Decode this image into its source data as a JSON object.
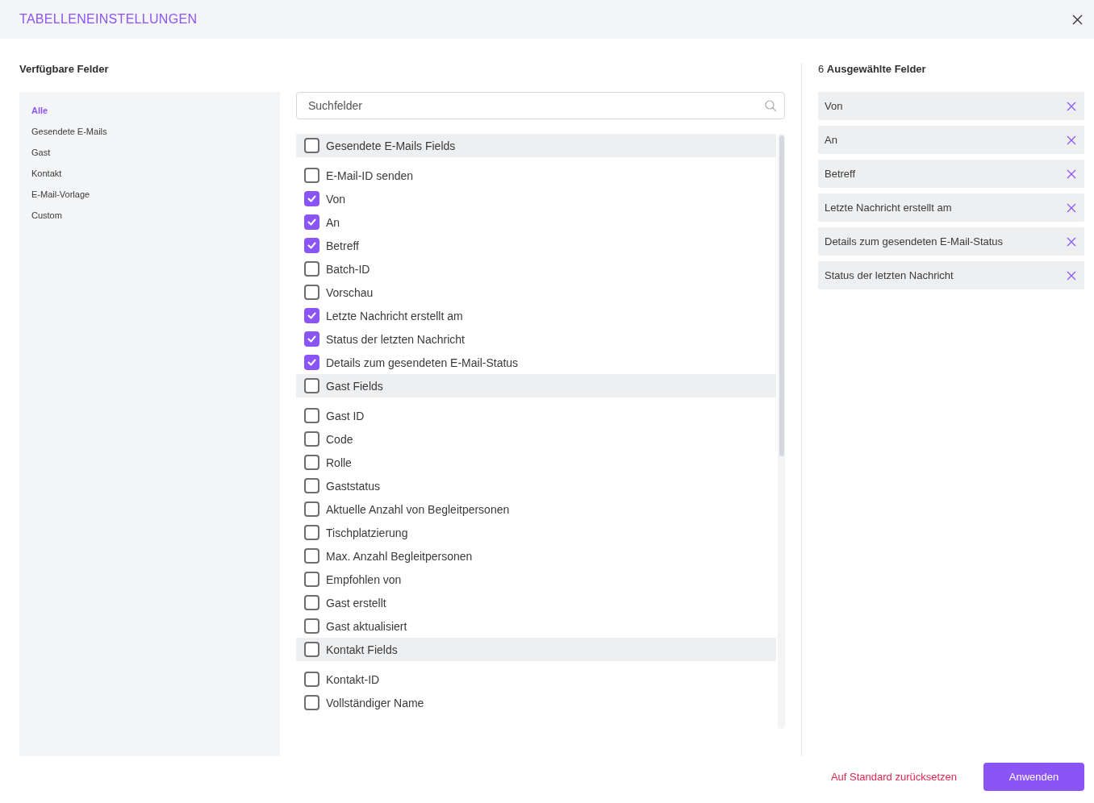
{
  "dialog": {
    "title": "TABELLENEINSTELLUNGEN"
  },
  "available": {
    "heading": "Verfügbare Felder",
    "categories": [
      {
        "label": "Alle",
        "selected": true
      },
      {
        "label": "Gesendete E-Mails",
        "selected": false
      },
      {
        "label": "Gast",
        "selected": false
      },
      {
        "label": "Kontakt",
        "selected": false
      },
      {
        "label": "E-Mail-Vorlage",
        "selected": false
      },
      {
        "label": "Custom",
        "selected": false
      }
    ],
    "search": {
      "placeholder": "Suchfelder"
    },
    "groups": [
      {
        "label": "Gesendete E-Mails Fields",
        "checked": false,
        "fields": [
          {
            "label": "E-Mail-ID senden",
            "checked": false
          },
          {
            "label": "Von",
            "checked": true
          },
          {
            "label": "An",
            "checked": true
          },
          {
            "label": "Betreff",
            "checked": true
          },
          {
            "label": "Batch-ID",
            "checked": false
          },
          {
            "label": "Vorschau",
            "checked": false
          },
          {
            "label": "Letzte Nachricht erstellt am",
            "checked": true
          },
          {
            "label": "Status der letzten Nachricht",
            "checked": true
          },
          {
            "label": "Details zum gesendeten E-Mail-Status",
            "checked": true
          }
        ]
      },
      {
        "label": "Gast Fields",
        "checked": false,
        "fields": [
          {
            "label": "Gast ID",
            "checked": false
          },
          {
            "label": "Code",
            "checked": false
          },
          {
            "label": "Rolle",
            "checked": false
          },
          {
            "label": "Gaststatus",
            "checked": false
          },
          {
            "label": "Aktuelle Anzahl von Begleitpersonen",
            "checked": false
          },
          {
            "label": "Tischplatzierung",
            "checked": false
          },
          {
            "label": "Max. Anzahl Begleitpersonen",
            "checked": false
          },
          {
            "label": "Empfohlen von",
            "checked": false
          },
          {
            "label": "Gast erstellt",
            "checked": false
          },
          {
            "label": "Gast aktualisiert",
            "checked": false
          }
        ]
      },
      {
        "label": "Kontakt Fields",
        "checked": false,
        "fields": [
          {
            "label": "Kontakt-ID",
            "checked": false
          },
          {
            "label": "Vollständiger Name",
            "checked": false
          }
        ]
      }
    ]
  },
  "selected": {
    "heading": "6 **Ausgewählte Felder**",
    "items": [
      "Von",
      "An",
      "Betreff",
      "Letzte Nachricht erstellt am",
      "Details zum gesendeten E-Mail-Status",
      "Status der letzten Nachricht"
    ]
  },
  "footer": {
    "reset": "Auf Standard zurücksetzen",
    "apply": "Anwenden"
  }
}
